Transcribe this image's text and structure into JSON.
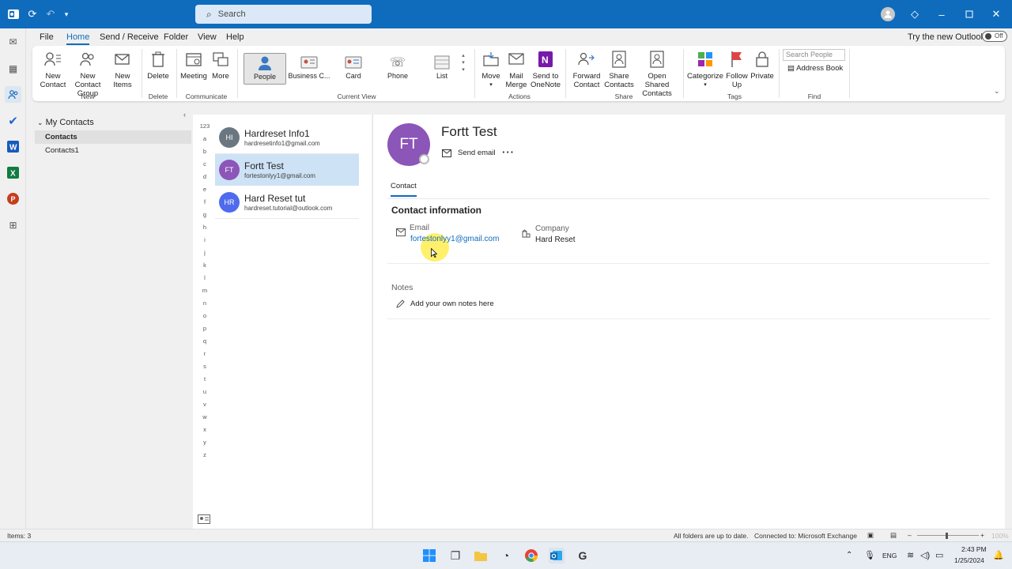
{
  "titlebar": {
    "search_placeholder": "Search"
  },
  "menu": {
    "items": [
      "File",
      "Home",
      "Send / Receive",
      "Folder",
      "View",
      "Help"
    ],
    "try_new": "Try the new Outlook",
    "toggle_label": "Off"
  },
  "ribbon": {
    "new_contact": "New\nContact",
    "new_contact_group": "New Contact\nGroup",
    "new_items": "New\nItems",
    "group_new": "New",
    "delete": "Delete",
    "group_delete": "Delete",
    "meeting": "Meeting",
    "more": "More",
    "group_communicate": "Communicate",
    "views": [
      "People",
      "Business C...",
      "Card",
      "Phone",
      "List"
    ],
    "group_current_view": "Current View",
    "move": "Move",
    "mail_merge": "Mail\nMerge",
    "send_to_onenote": "Send to\nOneNote",
    "group_actions": "Actions",
    "forward_contact": "Forward\nContact",
    "share_contacts": "Share\nContacts",
    "open_shared_contacts": "Open Shared\nContacts",
    "group_share": "Share",
    "categorize": "Categorize",
    "follow_up": "Follow\nUp",
    "private": "Private",
    "group_tags": "Tags",
    "search_people_placeholder": "Search People",
    "address_book": "Address Book",
    "group_find": "Find"
  },
  "folders": {
    "header": "My Contacts",
    "items": [
      "Contacts",
      "Contacts1"
    ]
  },
  "alphabet": [
    "123",
    "a",
    "b",
    "c",
    "d",
    "e",
    "f",
    "g",
    "h",
    "i",
    "j",
    "k",
    "l",
    "m",
    "n",
    "o",
    "p",
    "q",
    "r",
    "s",
    "t",
    "u",
    "v",
    "w",
    "x",
    "y",
    "z"
  ],
  "contacts": [
    {
      "initials": "HI",
      "name": "Hardreset Info1",
      "email": "hardresetinfo1@gmail.com",
      "color": "#6b7780"
    },
    {
      "initials": "FT",
      "name": "Fortt Test",
      "email": "fortestonlyy1@gmail.com",
      "color": "#8c55b8"
    },
    {
      "initials": "HR",
      "name": "Hard Reset tut",
      "email": "hardreset.tutorial@outlook.com",
      "color": "#4f6bed"
    }
  ],
  "detail": {
    "initials": "FT",
    "name": "Fortt Test",
    "send_email": "Send email",
    "tab": "Contact",
    "section_title": "Contact information",
    "email_label": "Email",
    "email_value": "fortestonlyy1@gmail.com",
    "company_label": "Company",
    "company_value": "Hard Reset",
    "notes_label": "Notes",
    "notes_add": "Add your own notes here"
  },
  "status": {
    "items": "Items: 3",
    "sync": "All folders are up to date.",
    "connection": "Connected to: Microsoft Exchange",
    "zoom": "100%"
  },
  "taskbar": {
    "lang": "ENG",
    "time": "2:43 PM",
    "date": "1/25/2024"
  },
  "colors": {
    "accent": "#0f6cbd",
    "selection": "#cde2f5"
  }
}
